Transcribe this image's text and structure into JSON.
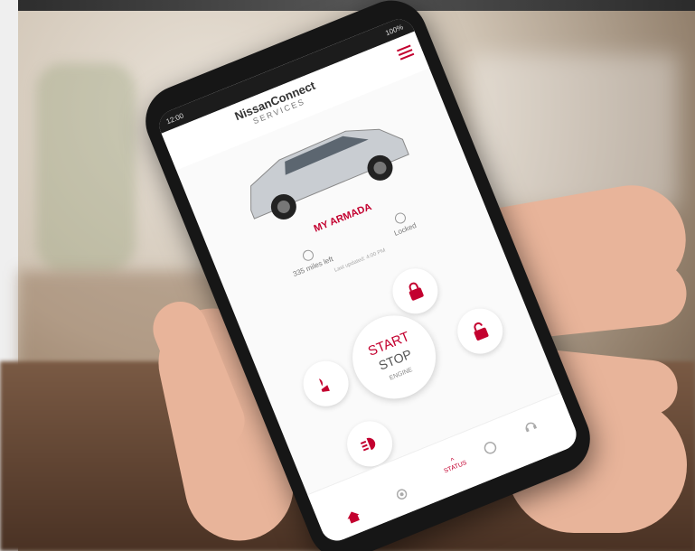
{
  "statusbar": {
    "time": "12:00",
    "battery": "100%"
  },
  "header": {
    "brand": "NissanConnect",
    "sub": "SERVICES"
  },
  "vehicle": {
    "name": "MY ARMADA",
    "range": "335 miles left",
    "lock_status": "Locked",
    "note": "Last updated: 4:00 PM"
  },
  "controls": {
    "engine_start": "START",
    "engine_stop": "STOP",
    "engine_label": "ENGINE"
  },
  "tabs": {
    "status": "STATUS"
  },
  "colors": {
    "accent": "#c3002f"
  }
}
